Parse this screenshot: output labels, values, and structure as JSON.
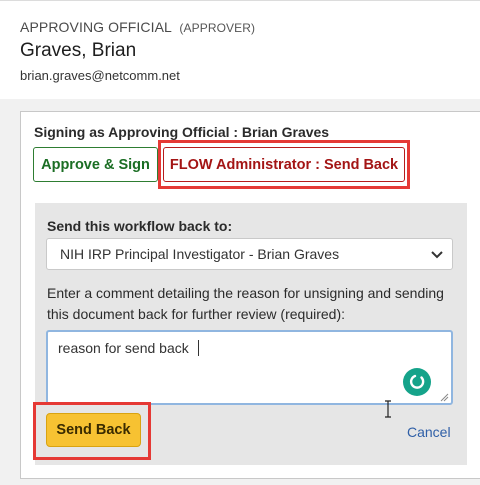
{
  "approver": {
    "role_label": "APPROVING OFFICIAL",
    "role_sub": "(APPROVER)",
    "name": "Graves, Brian",
    "email": "brian.graves@netcomm.net"
  },
  "signing": {
    "signing_as": "Signing as Approving Official : Brian Graves",
    "approve_label": "Approve & Sign",
    "send_back_tab_label": "FLOW Administrator : Send Back"
  },
  "send_back_form": {
    "send_to_label": "Send this workflow back to:",
    "selected_recipient": "NIH IRP Principal Investigator - Brian Graves",
    "comment_label": "Enter a comment detailing the reason for unsigning and sending this document back for further review (required):",
    "comment_value": "reason for send back",
    "send_back_button": "Send Back",
    "cancel_link": "Cancel"
  },
  "colors": {
    "approve_green": "#1b6e24",
    "send_back_red": "#a31515",
    "highlight_red": "#e53935",
    "send_back_yellow": "#f7c232",
    "link_blue": "#2f5fa7",
    "grammarly_green": "#15a38a"
  },
  "icons": {
    "dropdown": "chevron-down-icon",
    "assistant": "grammarly-icon",
    "resize": "resize-grip-icon",
    "cursor": "text-cursor-icon"
  }
}
